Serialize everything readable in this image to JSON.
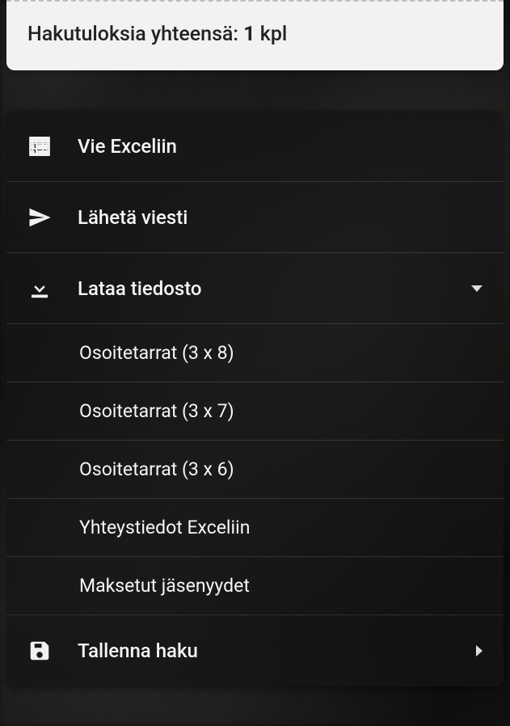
{
  "results_bar": {
    "label": "Hakutuloksia yhteensä: ",
    "count": "1",
    "unit": " kpl"
  },
  "menu": {
    "export_excel": "Vie Exceliin",
    "send_message": "Lähetä viesti",
    "download_file": "Lataa tiedosto",
    "download_subitems": {
      "labels_3x8": "Osoitetarrat (3 x 8)",
      "labels_3x7": "Osoitetarrat (3 x 7)",
      "labels_3x6": "Osoitetarrat (3 x 6)",
      "contacts_excel": "Yhteystiedot Exceliin",
      "paid_memberships": "Maksetut jäsenyydet"
    },
    "save_search": "Tallenna haku"
  }
}
